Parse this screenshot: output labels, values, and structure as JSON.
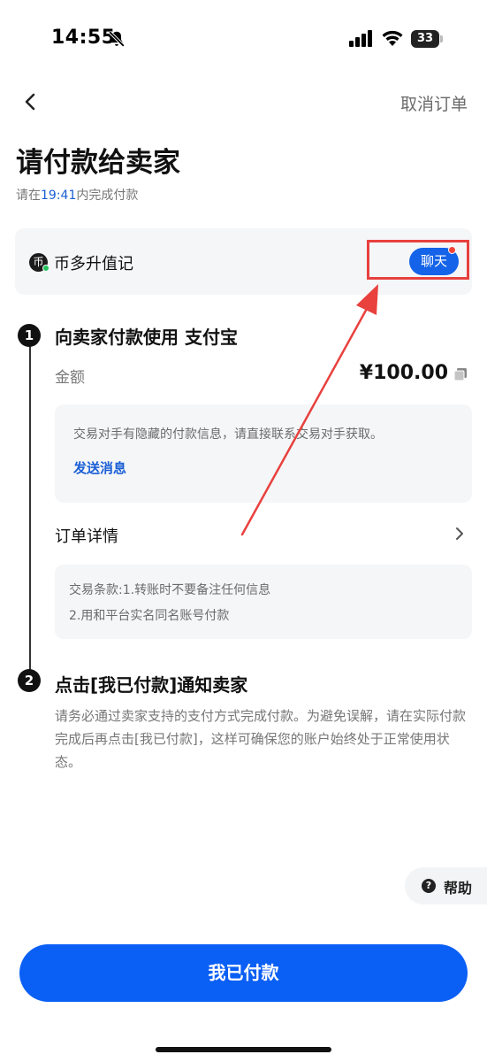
{
  "status_bar": {
    "time": "14:55",
    "battery": "33"
  },
  "nav": {
    "cancel_label": "取消订单"
  },
  "header": {
    "title": "请付款给卖家",
    "deadline_prefix": "请在",
    "deadline_time": "19:41",
    "deadline_suffix": "内完成付款"
  },
  "seller": {
    "avatar_glyph": "币",
    "name": "币多升值记",
    "chat_label": "聊天"
  },
  "step1": {
    "number": "1",
    "title": "向卖家付款使用 支付宝",
    "amount_label": "金额",
    "amount_value": "¥100.00",
    "info_text": "交易对手有隐藏的付款信息，请直接联系交易对手获取。",
    "send_message_label": "发送消息",
    "order_details_label": "订单详情",
    "terms_line1": "交易条款:1.转账时不要备注任何信息",
    "terms_line2": "2.用和平台实名同名账号付款"
  },
  "step2": {
    "number": "2",
    "title": "点击[我已付款]通知卖家",
    "description": "请务必通过卖家支持的支付方式完成付款。为避免误解，请在实际付款完成后再点击[我已付款]，这样可确保您的账户始终处于正常使用状态。"
  },
  "help": {
    "label": "帮助",
    "icon_glyph": "?"
  },
  "actions": {
    "paid_label": "我已付款"
  },
  "colors": {
    "accent": "#0a5ff5",
    "link": "#1a5fd6",
    "annotation": "#e8413e"
  }
}
